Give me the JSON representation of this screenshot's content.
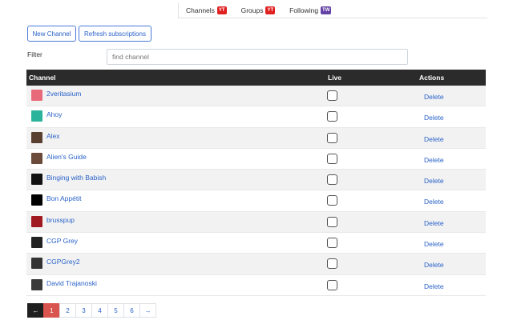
{
  "tabs": [
    {
      "label": "Channels",
      "badge": "YT",
      "badge_color": "#e02020"
    },
    {
      "label": "Groups",
      "badge": "YT",
      "badge_color": "#e02020"
    },
    {
      "label": "Following",
      "badge": "TW",
      "badge_color": "#6441a5"
    }
  ],
  "buttons": {
    "new_channel": "New Channel",
    "refresh": "Refresh subscriptions"
  },
  "filter": {
    "label": "Filter",
    "placeholder": "find channel"
  },
  "table": {
    "headers": {
      "channel": "Channel",
      "live": "Live",
      "actions": "Actions"
    },
    "rows": [
      {
        "name": "2veritasium",
        "action": "Delete",
        "avatar_color": "#e86a7a"
      },
      {
        "name": "Ahoy",
        "action": "Delete",
        "avatar_color": "#2bb39b"
      },
      {
        "name": "Alex",
        "action": "Delete",
        "avatar_color": "#5a4030"
      },
      {
        "name": "Alien's Guide",
        "action": "Delete",
        "avatar_color": "#6b4a3a"
      },
      {
        "name": "Binging with Babish",
        "action": "Delete",
        "avatar_color": "#111111"
      },
      {
        "name": "Bon Appétit",
        "action": "Delete",
        "avatar_color": "#000000"
      },
      {
        "name": "brusspup",
        "action": "Delete",
        "avatar_color": "#a01820"
      },
      {
        "name": "CGP Grey",
        "action": "Delete",
        "avatar_color": "#222222"
      },
      {
        "name": "CGPGrey2",
        "action": "Delete",
        "avatar_color": "#333333"
      },
      {
        "name": "David Trajanoski",
        "action": "Delete",
        "avatar_color": "#3a3a3a"
      }
    ]
  },
  "pagination": {
    "prev": "←",
    "pages": [
      "1",
      "2",
      "3",
      "4",
      "5",
      "6"
    ],
    "active_page": "1",
    "next": "→"
  }
}
